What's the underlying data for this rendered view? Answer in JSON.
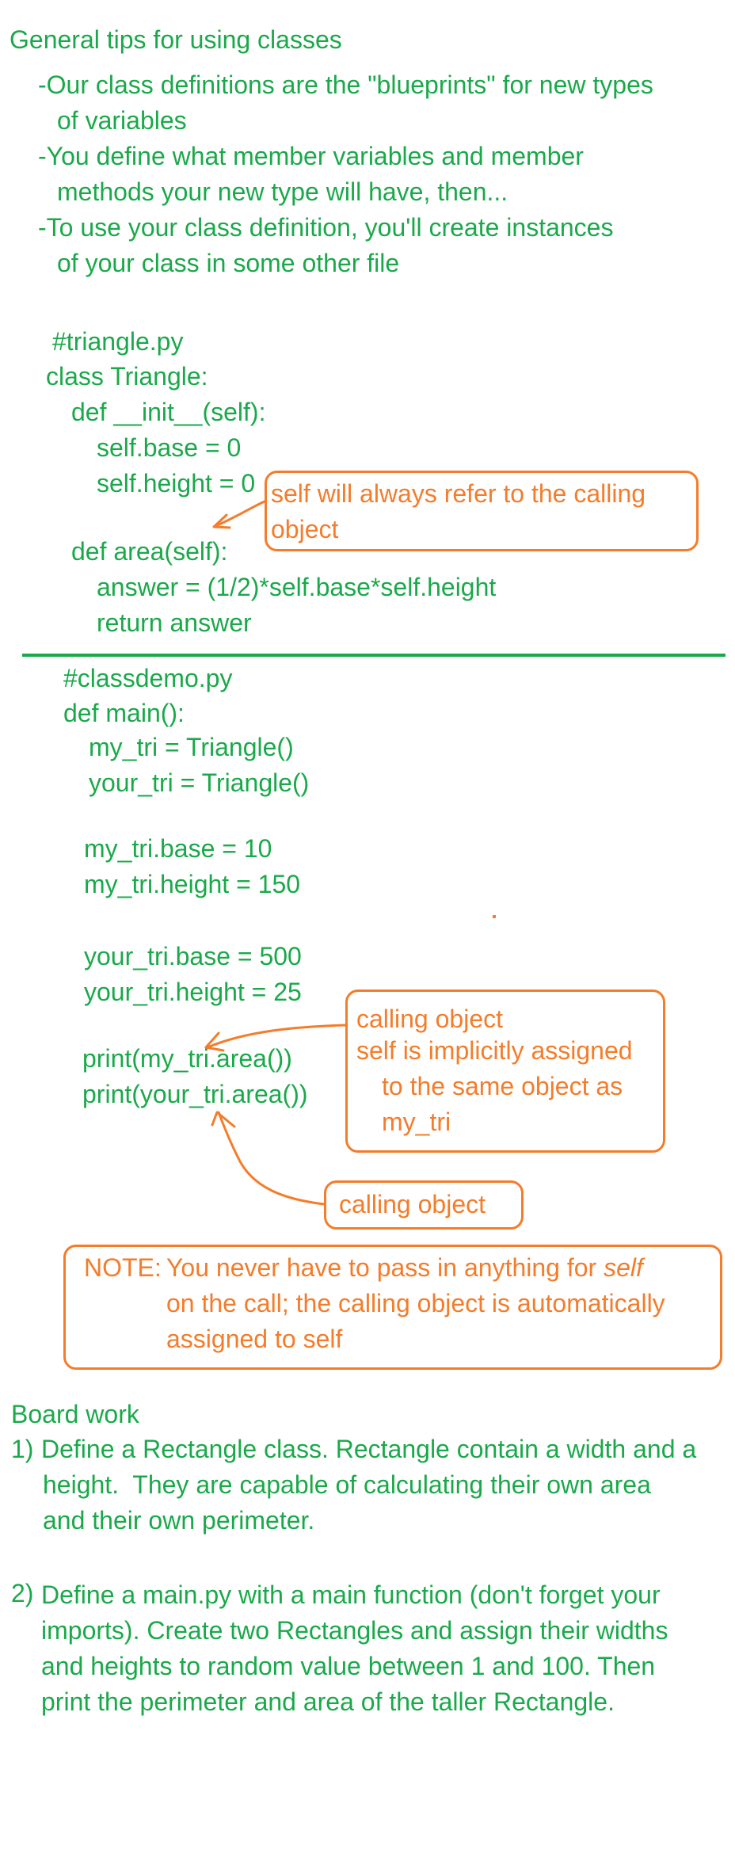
{
  "tips": {
    "heading": "General tips for using classes",
    "lines": [
      "-Our class definitions are the \"blueprints\" for new types",
      "of variables",
      "-You define what member variables and member",
      "methods your new type will have, then...",
      "-To use your class definition, you'll create instances",
      "of your class in some other file"
    ]
  },
  "triangle_code": [
    "#triangle.py",
    "class Triangle:",
    "def __init__(self):",
    "self.base = 0",
    "self.height = 0",
    "def area(self):",
    "answer = (1/2)*self.base*self.height",
    "return answer"
  ],
  "self_note": [
    "self will always refer to the calling",
    "object"
  ],
  "classdemo_code": [
    "#classdemo.py",
    "def main():",
    "my_tri = Triangle()",
    "your_tri = Triangle()",
    "my_tri.base = 10",
    "my_tri.height = 150",
    "your_tri.base = 500",
    "your_tri.height = 25",
    "print(my_tri.area())",
    "print(your_tri.area())"
  ],
  "calling_note": [
    "calling object",
    "self is implicitly assigned",
    "to the same object as",
    "my_tri"
  ],
  "calling_note2": "calling object",
  "note": {
    "prefix": "NOTE:",
    "line1_a": "You never have to pass in anything for",
    "line1_b": "self",
    "line2": "on the call; the calling object is automatically",
    "line3": "assigned to self"
  },
  "board": {
    "heading": "Board work",
    "item1_num": "1)",
    "item1": [
      "Define a Rectangle class. Rectangle contain a width and a",
      "height.  They are capable of calculating their own area",
      "and their own perimeter."
    ],
    "item2_num": "2)",
    "item2": [
      "Define a main.py with a main function (don't forget your",
      "imports). Create two Rectangles and assign their widths",
      "and heights to random value between 1 and 100. Then",
      "print the perimeter and area of the taller Rectangle."
    ]
  },
  "colors": {
    "green": "#1aa94a",
    "orange": "#f47c2a"
  }
}
